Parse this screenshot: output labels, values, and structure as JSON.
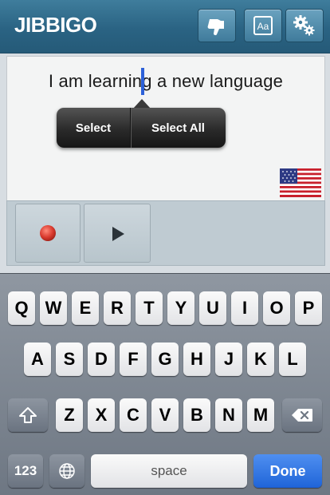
{
  "header": {
    "logo": "JIBBIGO",
    "buttons": [
      {
        "name": "thumbs-down",
        "icon": "thumbs-down-icon"
      },
      {
        "name": "font-size",
        "label": "Aa",
        "icon": "font-size-icon"
      },
      {
        "name": "settings",
        "icon": "gears-icon"
      }
    ]
  },
  "text_panel": {
    "phrase": "I am learning a new language",
    "popup": {
      "select_label": "Select",
      "select_all_label": "Select All"
    },
    "flag_icon": "us-flag-icon"
  },
  "controls": {
    "record_icon": "record-icon",
    "play_icon": "play-icon",
    "record_color": "#d93a2e"
  },
  "keyboard": {
    "row1": [
      "Q",
      "W",
      "E",
      "R",
      "T",
      "Y",
      "U",
      "I",
      "O",
      "P"
    ],
    "row2": [
      "A",
      "S",
      "D",
      "F",
      "G",
      "H",
      "J",
      "K",
      "L"
    ],
    "row3": [
      "Z",
      "X",
      "C",
      "V",
      "B",
      "N",
      "M"
    ],
    "numbers_label": "123",
    "space_label": "space",
    "done_label": "Done",
    "accent_color": "#2a6383"
  }
}
